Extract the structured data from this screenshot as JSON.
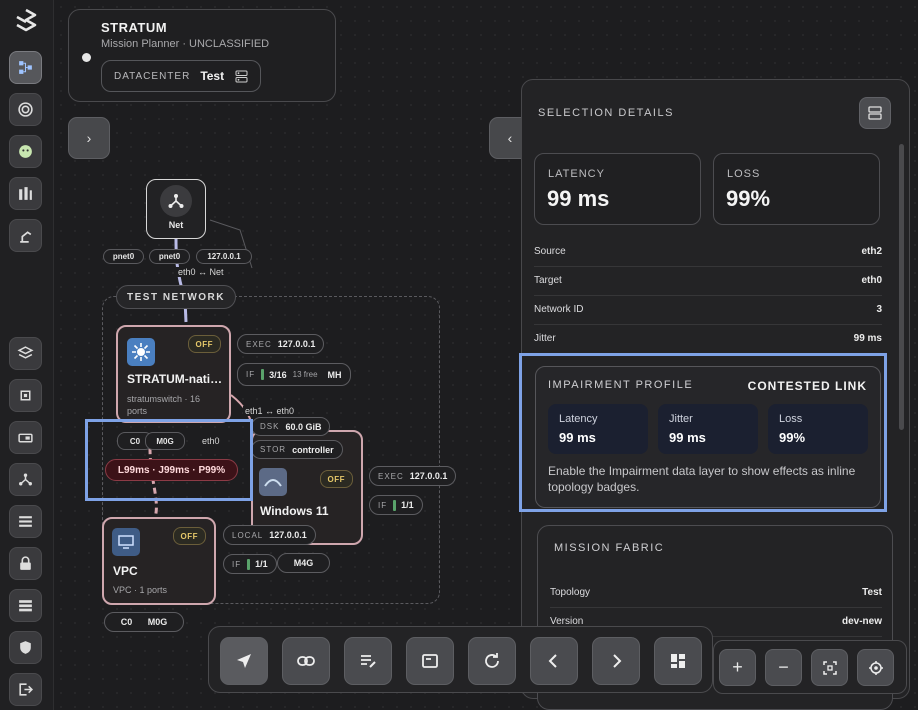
{
  "app": {
    "title": "STRATUM",
    "subtitle": "Mission Planner · UNCLASSIFIED",
    "datacenter_label": "DATACENTER",
    "datacenter_value": "Test"
  },
  "topology": {
    "net_node": {
      "label": "Net"
    },
    "net_chips": [
      "pnet0",
      "pnet0",
      "127.0.0.1"
    ],
    "edge_net": "eth0 ↔ Net",
    "group_label": "TEST NETWORK",
    "switch": {
      "status": "OFF",
      "name": "STRATUM-nati…",
      "meta1": "stratumswitch · 16",
      "meta2": "ports",
      "exec_key": "EXEC",
      "exec_val": "127.0.0.1",
      "if_key": "IF",
      "if_val": "3/16",
      "if_free": "13 free",
      "if_extra": "MH"
    },
    "edge_sw_win": "eth1 ↔ eth0",
    "windows": {
      "status": "OFF",
      "name": "Windows 11",
      "dsk_key": "DSK",
      "dsk_val": "60.0 GiB",
      "stor_key": "STOR",
      "stor_val": "controller",
      "exec_key": "EXEC",
      "exec_val": "127.0.0.1",
      "if_key": "IF",
      "if_val": "1/1",
      "mem": "M4G"
    },
    "vpc": {
      "status": "OFF",
      "name": "VPC",
      "meta": "VPC · 1 ports",
      "local_key": "LOCAL",
      "local_val": "127.0.0.1",
      "if_key": "IF",
      "if_val": "1/1",
      "chip_c": "C0",
      "chip_m": "M0G"
    },
    "link_chip": {
      "c": "C0",
      "m": "M0G",
      "edge": "eth0"
    },
    "impairment_badge": "L99ms · J99ms · P99%"
  },
  "panel": {
    "title": "SELECTION DETAILS",
    "latency_label": "LATENCY",
    "latency_value": "99 ms",
    "loss_label": "LOSS",
    "loss_value": "99%",
    "rows": [
      {
        "k": "Source",
        "v": "eth2"
      },
      {
        "k": "Target",
        "v": "eth0"
      },
      {
        "k": "Network ID",
        "v": "3"
      },
      {
        "k": "Jitter",
        "v": "99 ms"
      }
    ],
    "impairment": {
      "title": "IMPAIRMENT PROFILE",
      "profile": "CONTESTED LINK",
      "cells": [
        {
          "k": "Latency",
          "v": "99 ms"
        },
        {
          "k": "Jitter",
          "v": "99 ms"
        },
        {
          "k": "Loss",
          "v": "99%"
        }
      ],
      "description": "Enable the Impairment data layer to show effects as inline topology badges."
    },
    "fabric": {
      "title": "MISSION FABRIC",
      "rows": [
        {
          "k": "Topology",
          "v": "Test"
        },
        {
          "k": "Version",
          "v": "dev-new"
        }
      ]
    }
  },
  "colors": {
    "accent_highlight": "#7ea2e6",
    "node_border": "#cfa7ae",
    "off_text": "#e5c86a",
    "impairment_badge_bg": "#3c1218"
  }
}
